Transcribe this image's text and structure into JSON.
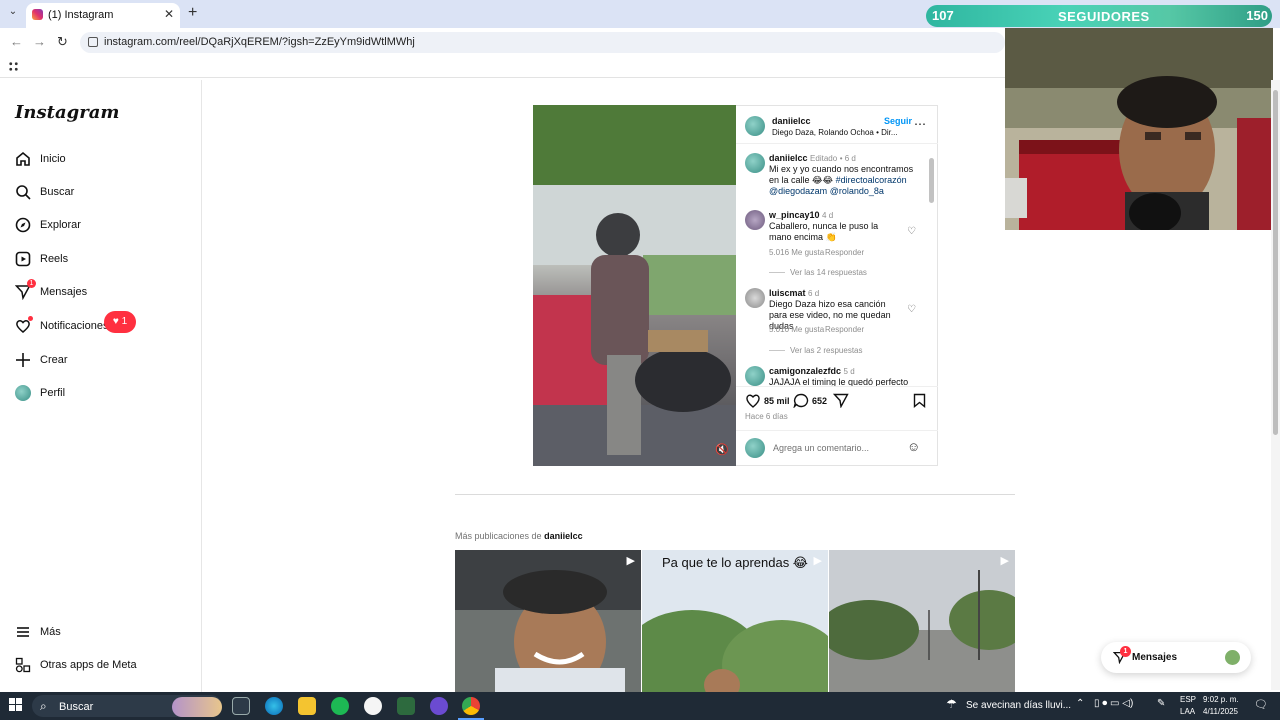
{
  "browser": {
    "tab_title": "(1) Instagram",
    "url": "instagram.com/reel/DQaRjXqEREM/?igsh=ZzEyYm9idWtlMWhj"
  },
  "overlay": {
    "left_count": "107",
    "label": "SEGUIDORES",
    "right_count": "150"
  },
  "sidebar": {
    "logo": "Instagram",
    "items": [
      {
        "label": "Inicio",
        "icon": "home-icon"
      },
      {
        "label": "Buscar",
        "icon": "search-icon"
      },
      {
        "label": "Explorar",
        "icon": "compass-icon"
      },
      {
        "label": "Reels",
        "icon": "reels-icon"
      },
      {
        "label": "Mensajes",
        "icon": "messenger-icon"
      },
      {
        "label": "Notificaciones",
        "icon": "heart-icon"
      },
      {
        "label": "Crear",
        "icon": "plus-icon"
      },
      {
        "label": "Perfil",
        "icon": "avatar"
      }
    ],
    "notifications_badge": "1",
    "messages_badge": "1",
    "bottom_items": [
      {
        "label": "Más",
        "icon": "menu-icon"
      },
      {
        "label": "Otras apps de Meta",
        "icon": "meta-apps-icon"
      }
    ]
  },
  "post": {
    "username": "daniielcc",
    "follow": "Seguir",
    "audio": "Diego Daza, Rolando Ochoa • Dir...",
    "caption_user": "daniielcc",
    "caption_edited": "Editado",
    "caption_age": "6 d",
    "caption_text": "Mi ex y yo cuando nos encontramos en la calle 😂😂",
    "caption_tag1": "#directoalcorazón",
    "caption_mention1": "@diegodazam",
    "caption_mention2": "@rolando_8a",
    "comments": [
      {
        "user": "w_pincay10",
        "age": "4 d",
        "text": "Caballero, nunca le puso la mano encima 👏",
        "likes": "5.016 Me gusta",
        "reply": "Responder",
        "view_replies": "Ver las 14 respuestas"
      },
      {
        "user": "luiscmat",
        "age": "6 d",
        "text": "Diego Daza hizo esa canción para ese video, no me quedan dudas",
        "likes": "5.010 Me gusta",
        "reply": "Responder",
        "view_replies": "Ver las 2 respuestas"
      },
      {
        "user": "camigonzalezfdc",
        "age": "5 d",
        "text": "JAJAJA el timing le quedó perfecto"
      }
    ],
    "likes": "85 mil",
    "comments_count": "652",
    "age": "Hace 6 días",
    "comment_placeholder": "Agrega un comentario..."
  },
  "more": {
    "prefix": "Más publicaciones de",
    "user": "daniielcc",
    "thumb2_caption": "Pa que te lo aprendas 😂"
  },
  "messages_button": {
    "label": "Mensajes",
    "badge": "1"
  },
  "taskbar": {
    "search": "Buscar",
    "weather": "Se avecinan días lluvi...",
    "lang": "ESP",
    "lang2": "LAA",
    "time": "9:02 p. m.",
    "date": "4/11/2025"
  }
}
